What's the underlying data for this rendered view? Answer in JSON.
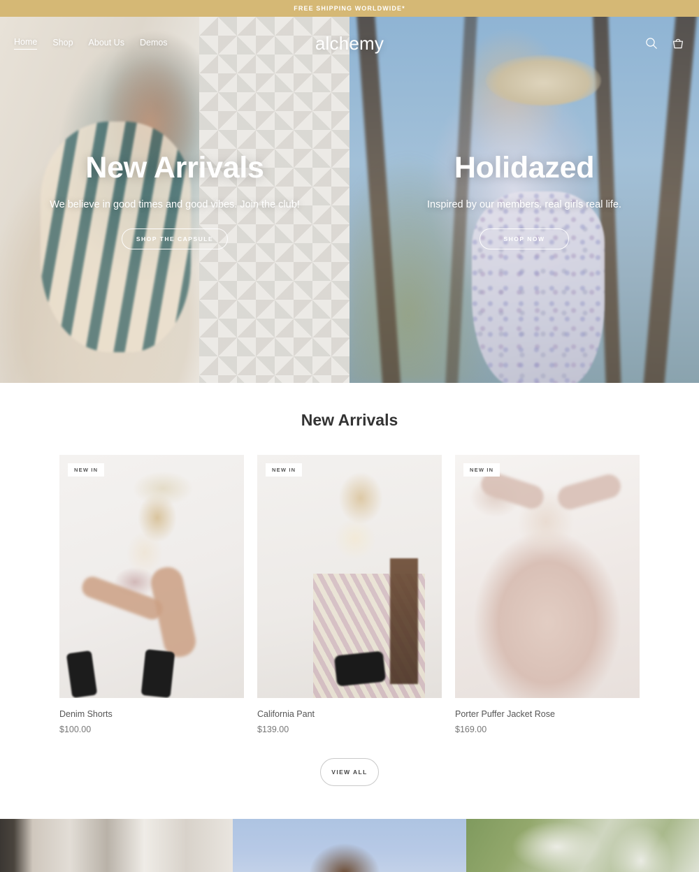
{
  "announcement": {
    "text": "FREE SHIPPING WORLDWIDE*",
    "background": "#d5b875"
  },
  "header": {
    "logo": "alchemy",
    "nav": [
      {
        "label": "Home",
        "active": true
      },
      {
        "label": "Shop",
        "active": false
      },
      {
        "label": "About Us",
        "active": false
      },
      {
        "label": "Demos",
        "active": false
      }
    ],
    "icons": [
      {
        "name": "search-icon",
        "label": "Search"
      },
      {
        "name": "cart-icon",
        "label": "Cart"
      }
    ]
  },
  "hero": {
    "slides": [
      {
        "title": "New Arrivals",
        "subtitle": "We believe in good times and good vibes. Join the club!",
        "button": "SHOP THE CAPSULE"
      },
      {
        "title": "Holidazed",
        "subtitle": "Inspired by our members. real girls real life.",
        "button": "SHOP NOW"
      }
    ]
  },
  "new_arrivals": {
    "title": "New Arrivals",
    "badge_label": "NEW IN",
    "products": [
      {
        "name": "Denim Shorts",
        "price": "$100.00",
        "badge": "NEW IN"
      },
      {
        "name": "California Pant",
        "price": "$139.00",
        "badge": "NEW IN"
      },
      {
        "name": "Porter Puffer Jacket Rose",
        "price": "$169.00",
        "badge": "NEW IN"
      }
    ],
    "view_all": "VIEW ALL"
  },
  "bottom_strip": {
    "panels": [
      {
        "name": "lookbook-panel-1"
      },
      {
        "name": "lookbook-panel-2"
      },
      {
        "name": "lookbook-panel-3"
      }
    ]
  }
}
